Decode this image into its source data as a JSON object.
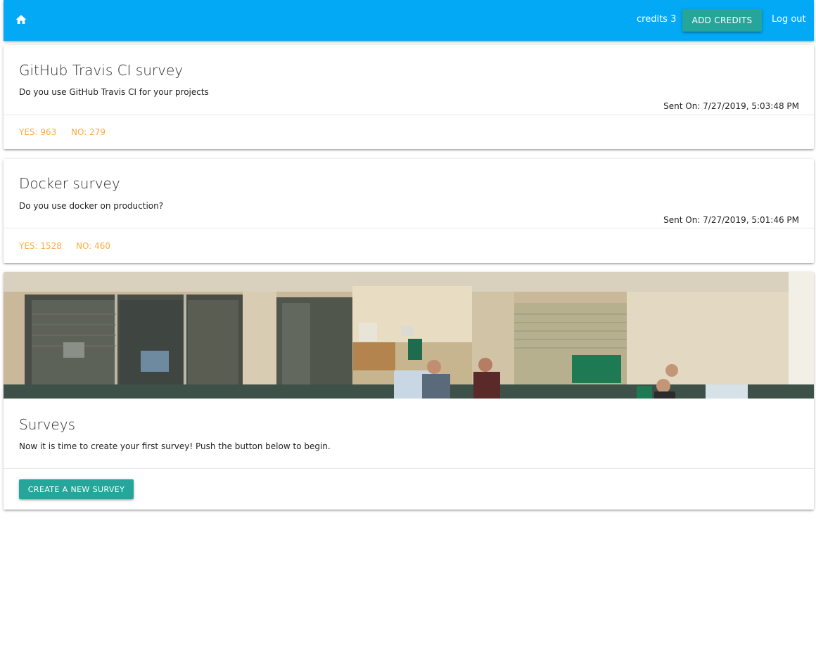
{
  "navbar": {
    "home_icon": "home-icon",
    "credits_label": "credits 3",
    "add_credits_label": "ADD CREDITS",
    "logout_label": "Log out",
    "color": "#03a9f4"
  },
  "surveys": [
    {
      "title": "GitHub Travis CI survey",
      "body": "Do you use GitHub Travis CI for your projects",
      "sent_on": "Sent On: 7/27/2019, 5:03:48 PM",
      "yes": "YES: 963",
      "no": "NO: 279"
    },
    {
      "title": "Docker survey",
      "body": "Do you use docker on production?",
      "sent_on": "Sent On: 7/27/2019, 5:01:46 PM",
      "yes": "YES: 1528",
      "no": "NO: 460"
    }
  ],
  "intro_card": {
    "image": "office-photo",
    "title": "Surveys",
    "body": "Now it is time to create your first survey! Push the button below to begin.",
    "button_label": "CREATE A NEW SURVEY"
  },
  "colors": {
    "accent": "#26a69a",
    "vote": "#ffab40"
  }
}
